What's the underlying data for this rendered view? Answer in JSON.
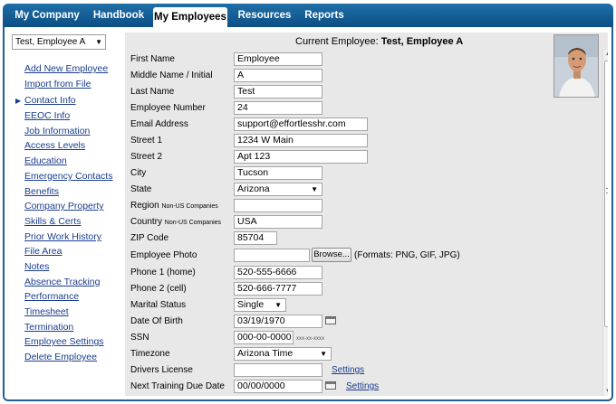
{
  "nav": {
    "tabs": [
      {
        "label": "My Company"
      },
      {
        "label": "Handbook"
      },
      {
        "label": "My Employees"
      },
      {
        "label": "Resources"
      },
      {
        "label": "Reports"
      }
    ],
    "active": "My Employees"
  },
  "sidebar": {
    "employee_select": "Test, Employee A",
    "links": [
      {
        "label": "Add New Employee"
      },
      {
        "label": "Import from File"
      },
      {
        "label": "Contact Info",
        "current": true
      },
      {
        "label": "EEOC Info"
      },
      {
        "label": "Job Information"
      },
      {
        "label": "Access Levels"
      },
      {
        "label": "Education"
      },
      {
        "label": "Emergency Contacts"
      },
      {
        "label": "Benefits"
      },
      {
        "label": "Company Property"
      },
      {
        "label": "Skills & Certs"
      },
      {
        "label": "Prior Work History"
      },
      {
        "label": "File Area"
      },
      {
        "label": "Notes"
      },
      {
        "label": "Absence Tracking"
      },
      {
        "label": "Performance"
      },
      {
        "label": "Timesheet"
      },
      {
        "label": "Termination"
      },
      {
        "label": "Employee Settings"
      },
      {
        "label": "Delete Employee"
      }
    ]
  },
  "form": {
    "current_employee_label": "Current Employee:",
    "current_employee_name": "Test, Employee A",
    "fields": {
      "first_name": {
        "label": "First Name",
        "value": "Employee"
      },
      "middle_name": {
        "label": "Middle Name / Initial",
        "value": "A"
      },
      "last_name": {
        "label": "Last Name",
        "value": "Test"
      },
      "employee_number": {
        "label": "Employee Number",
        "value": "24"
      },
      "email": {
        "label": "Email Address",
        "value": "support@effortlesshr.com"
      },
      "street1": {
        "label": "Street 1",
        "value": "1234 W Main"
      },
      "street2": {
        "label": "Street 2",
        "value": "Apt 123"
      },
      "city": {
        "label": "City",
        "value": "Tucson"
      },
      "state": {
        "label": "State",
        "value": "Arizona"
      },
      "region": {
        "label": "Region",
        "note": "Non-US Companies",
        "value": ""
      },
      "country": {
        "label": "Country",
        "note": "Non-US Companies",
        "value": "USA"
      },
      "zip": {
        "label": "ZIP Code",
        "value": "85704"
      },
      "photo": {
        "label": "Employee Photo",
        "value": "",
        "browse": "Browse...",
        "formats": "(Formats: PNG, GIF, JPG)"
      },
      "phone1": {
        "label": "Phone 1 (home)",
        "value": "520-555-6666"
      },
      "phone2": {
        "label": "Phone 2 (cell)",
        "value": "520-666-7777"
      },
      "marital": {
        "label": "Marital Status",
        "value": "Single"
      },
      "dob": {
        "label": "Date Of Birth",
        "value": "03/19/1970"
      },
      "ssn": {
        "label": "SSN",
        "value": "000-00-0000",
        "hint": "xxx-xx-xxxx"
      },
      "timezone": {
        "label": "Timezone",
        "value": "Arizona Time"
      },
      "drivers_license": {
        "label": "Drivers License",
        "value": "",
        "link": "Settings"
      },
      "next_training": {
        "label": "Next Training Due Date",
        "value": "00/00/0000",
        "link": "Settings"
      }
    }
  }
}
